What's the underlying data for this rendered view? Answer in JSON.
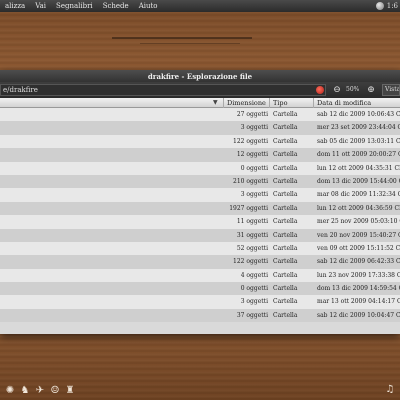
{
  "menubar": {
    "items": [
      "alizza",
      "Vai",
      "Segnalibri",
      "Schede",
      "Aiuto"
    ],
    "clock": "1:6"
  },
  "window": {
    "title": "drakfire - Esplorazione file",
    "location": "e/drakfire",
    "zoom_level": "50%",
    "view_label": "Vista"
  },
  "columns": {
    "size": "Dimensione",
    "type": "Tipo",
    "date": "Data di modifica"
  },
  "files": [
    {
      "size": "27 oggetti",
      "type": "Cartella",
      "date": "sab 12 dic 2009 10:06:43 CET"
    },
    {
      "size": "3 oggetti",
      "type": "Cartella",
      "date": "mer 23 set 2009 23:44:04 CEST"
    },
    {
      "size": "122 oggetti",
      "type": "Cartella",
      "date": "sab 05 dic 2009 13:03:11 CET"
    },
    {
      "size": "12 oggetti",
      "type": "Cartella",
      "date": "dom 11 ott 2009 20:00:27 CEST"
    },
    {
      "size": "0 oggetti",
      "type": "Cartella",
      "date": "lun 12 ott 2009 04:35:31 CEST"
    },
    {
      "size": "210 oggetti",
      "type": "Cartella",
      "date": "dom 13 dic 2009 15:44:00 CET"
    },
    {
      "size": "3 oggetti",
      "type": "Cartella",
      "date": "mar 08 dic 2009 11:32:34 CET"
    },
    {
      "size": "1927 oggetti",
      "type": "Cartella",
      "date": "lun 12 ott 2009 04:36:59 CEST"
    },
    {
      "size": "11 oggetti",
      "type": "Cartella",
      "date": "mer 25 nov 2009 05:03:10 CET"
    },
    {
      "size": "31 oggetti",
      "type": "Cartella",
      "date": "ven 20 nov 2009 15:40:27 CET"
    },
    {
      "size": "52 oggetti",
      "type": "Cartella",
      "date": "ven 09 ott 2009 15:11:52 CEST"
    },
    {
      "size": "122 oggetti",
      "type": "Cartella",
      "date": "sab 12 dic 2009 06:42:33 CET"
    },
    {
      "size": "4 oggetti",
      "type": "Cartella",
      "date": "lun 23 nov 2009 17:33:38 CET"
    },
    {
      "size": "0 oggetti",
      "type": "Cartella",
      "date": "dom 13 dic 2009 14:59:54 CET"
    },
    {
      "size": "3 oggetti",
      "type": "Cartella",
      "date": "mar 13 ott 2009 04:14:17 CEST"
    },
    {
      "size": "37 oggetti",
      "type": "Cartella",
      "date": "sab 12 dic 2009 10:04:47 CET"
    }
  ],
  "dock": {
    "icons": [
      "swirl-icon",
      "bird-icon",
      "compass-icon",
      "smiley-icon",
      "puzzle-icon",
      "music-icon"
    ]
  }
}
